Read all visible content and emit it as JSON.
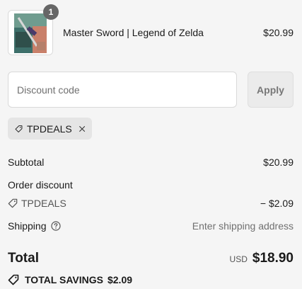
{
  "line_item": {
    "quantity": "1",
    "name": "Master Sword | Legend of Zelda",
    "price": "$20.99"
  },
  "discount": {
    "placeholder": "Discount code",
    "apply_label": "Apply",
    "applied_code": "TPDEALS"
  },
  "summary": {
    "subtotal_label": "Subtotal",
    "subtotal_value": "$20.99",
    "order_discount_label": "Order discount",
    "discount_code": "TPDEALS",
    "discount_value": "− $2.09",
    "shipping_label": "Shipping",
    "shipping_value": "Enter shipping address",
    "total_label": "Total",
    "total_currency": "USD",
    "total_value": "$18.90",
    "savings_label": "TOTAL SAVINGS",
    "savings_value": "$2.09"
  },
  "colors": {
    "background": "#f5f5f5",
    "badge": "#666666",
    "tag_bg": "#e5e5e5"
  }
}
